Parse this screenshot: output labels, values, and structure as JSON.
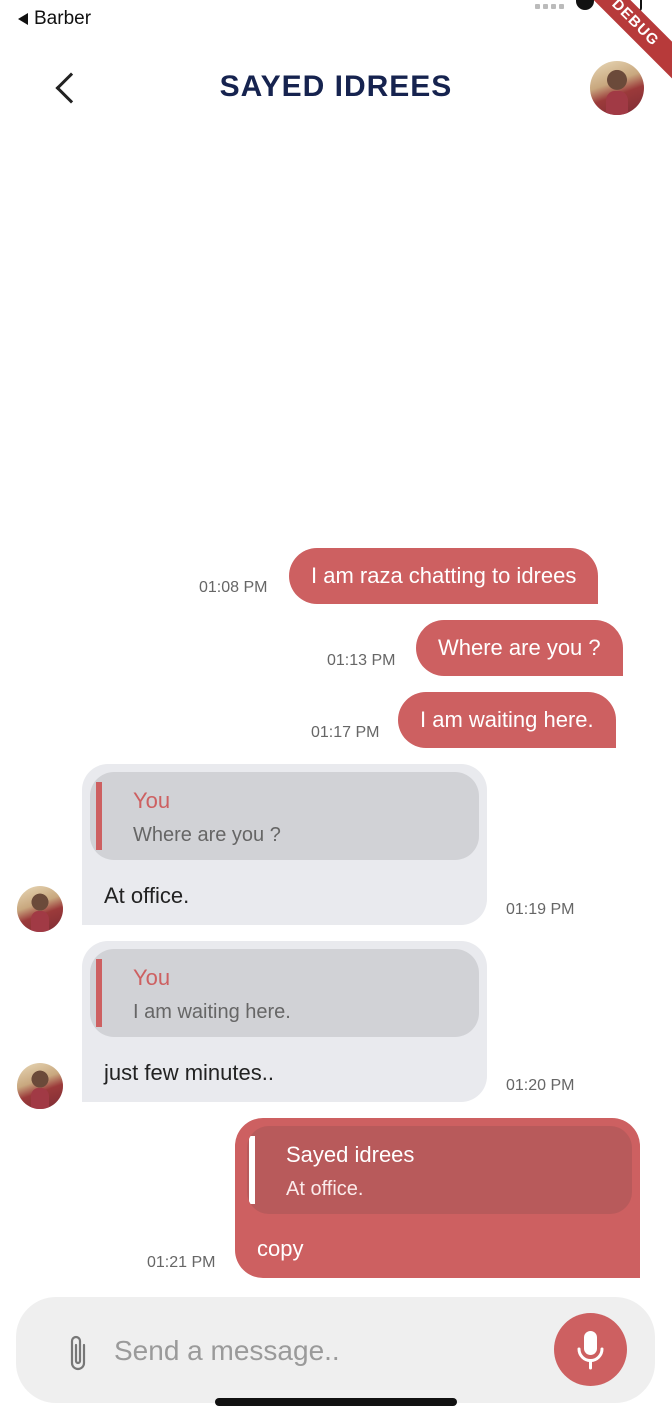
{
  "status_bar": {
    "back_app": "Barber"
  },
  "debug_ribbon": "DEBUG",
  "header": {
    "title": "SAYED IDREES"
  },
  "messages": [
    {
      "text": "I am raza chatting to idrees",
      "time": "01:08 PM"
    },
    {
      "text": "Where are you ?",
      "time": "01:13 PM"
    },
    {
      "text": "I am waiting here.",
      "time": "01:17 PM"
    },
    {
      "reply_name": "You",
      "reply_text": "Where are you ?",
      "text": "At office.",
      "time": "01:19 PM"
    },
    {
      "reply_name": "You",
      "reply_text": "I am waiting here.",
      "text": "just few minutes..",
      "time": "01:20 PM"
    },
    {
      "reply_name": "Sayed idrees",
      "reply_text": "At office.",
      "text": "copy",
      "time": "01:21 PM"
    }
  ],
  "composer": {
    "placeholder": "Send a message.."
  },
  "colors": {
    "accent": "#cd6061",
    "title": "#16234f",
    "incoming_bubble": "#e9eaee"
  },
  "icons": [
    "back-chevron-icon",
    "paperclip-icon",
    "microphone-icon"
  ]
}
